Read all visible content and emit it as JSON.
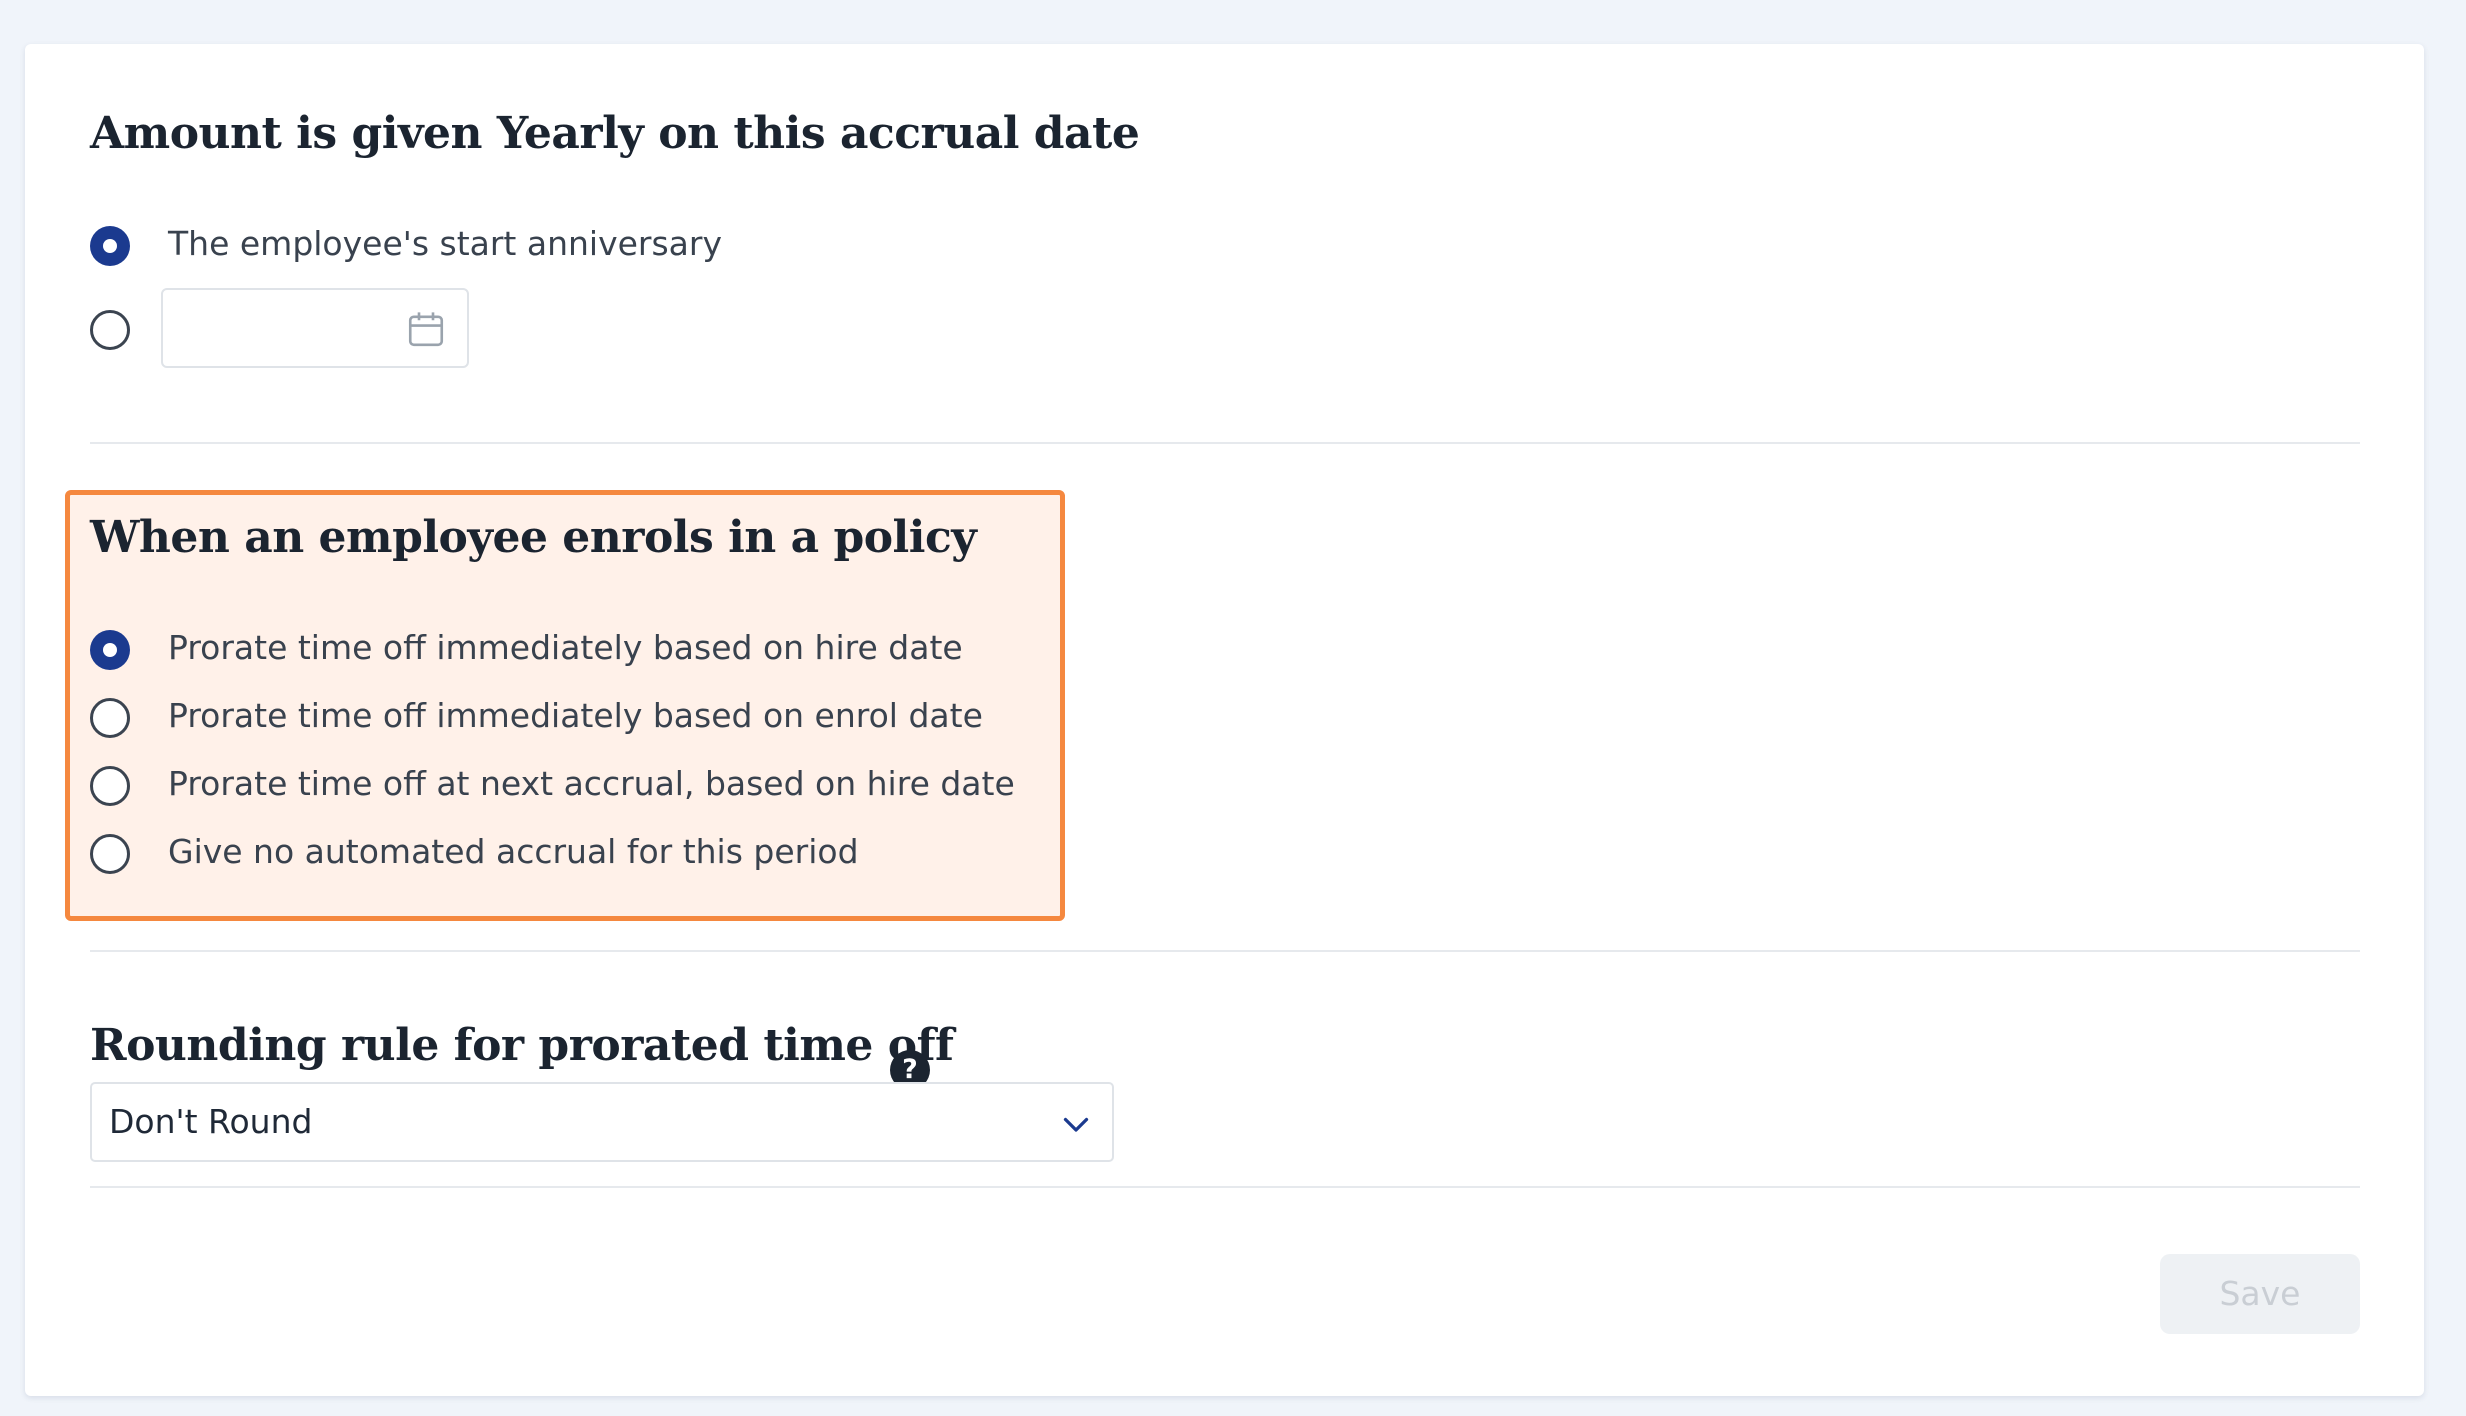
{
  "accrual_date_section": {
    "heading": "Amount is given Yearly on this accrual date",
    "options": [
      {
        "label": "The employee's start anniversary",
        "checked": true
      },
      {
        "label": "",
        "checked": false,
        "date_value": ""
      }
    ]
  },
  "enrol_section": {
    "heading": "When an employee enrols in a policy",
    "options": [
      {
        "label": "Prorate time off immediately based on hire date",
        "checked": true
      },
      {
        "label": "Prorate time off immediately based on enrol date",
        "checked": false
      },
      {
        "label": "Prorate time off at next accrual, based on hire date",
        "checked": false
      },
      {
        "label": "Give no automated accrual for this period",
        "checked": false
      }
    ]
  },
  "rounding_section": {
    "heading": "Rounding rule for prorated time off",
    "help_icon_glyph": "?",
    "selected_value": "Don't Round"
  },
  "footer": {
    "save_label": "Save"
  },
  "colors": {
    "radio_checked": "#1b3a8f",
    "highlight_border": "#f5883f",
    "highlight_fill": "#fff1e9",
    "page_background": "#f0f4fa"
  },
  "icons": {
    "date_picker": "calendar-icon",
    "select_caret": "chevron-down-icon",
    "help": "question-circle-icon"
  }
}
